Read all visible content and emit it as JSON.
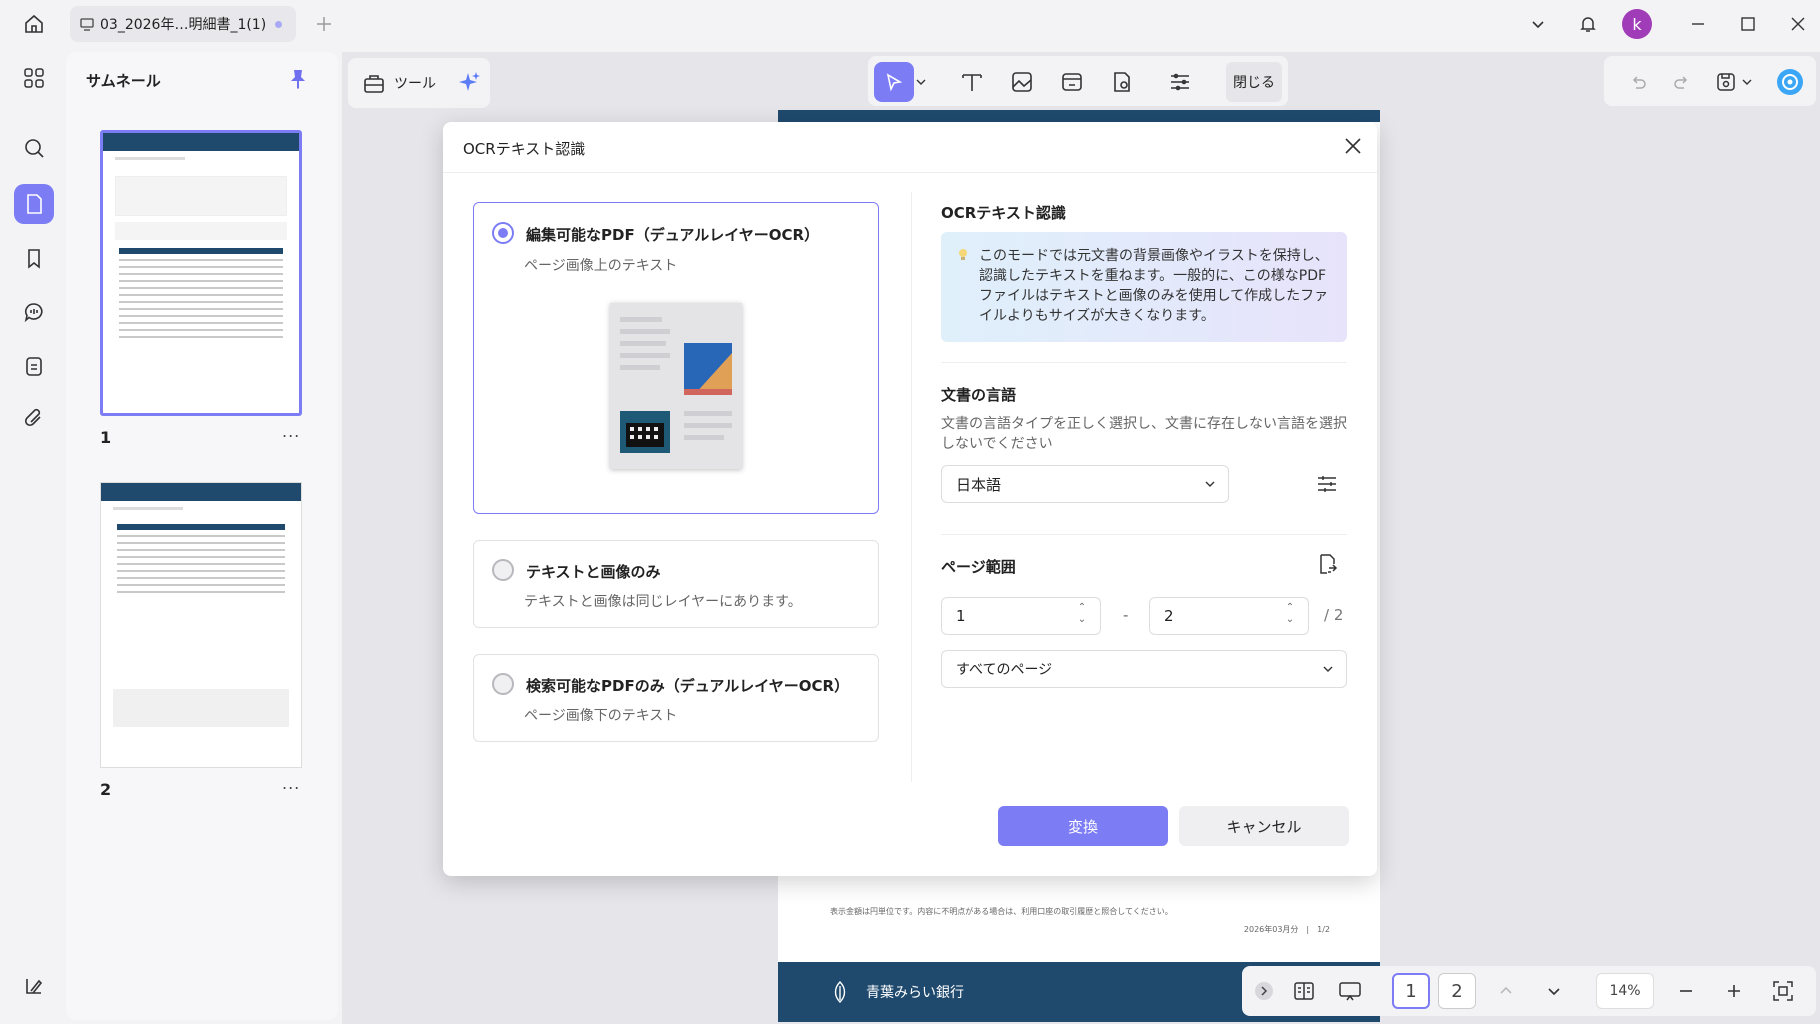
{
  "window": {
    "tab_title": "03_2026年…明細書_1(1)",
    "avatar_letter": "k",
    "accent_color": "#7c7cf5"
  },
  "sidebar": {
    "title": "サムネール",
    "pages": [
      {
        "number": "1",
        "more": "..."
      },
      {
        "number": "2",
        "more": "..."
      }
    ]
  },
  "toolbar": {
    "tools_label": "ツール",
    "close_label": "閉じる"
  },
  "document": {
    "footer_note": "表示金額は円単位です。内容に不明点がある場合は、利用口座の取引履歴と照合してください。",
    "footer_date": "2026年03月分　|　1/2",
    "bank_name": "青葉みらい銀行"
  },
  "bottombar": {
    "page1": "1",
    "page2": "2",
    "zoom": "14%"
  },
  "dialog": {
    "title": "OCRテキスト認識",
    "options": [
      {
        "title": "編集可能なPDF（デュアルレイヤーOCR）",
        "subtitle": "ページ画像上のテキスト"
      },
      {
        "title": "テキストと画像のみ",
        "subtitle": "テキストと画像は同じレイヤーにあります。"
      },
      {
        "title": "検索可能なPDFのみ（デュアルレイヤーOCR）",
        "subtitle": "ページ画像下のテキスト"
      }
    ],
    "right_heading": "OCRテキスト認識",
    "info": "このモードでは元文書の背景画像やイラストを保持し、認識したテキストを重ねます。一般的に、この様なPDFファイルはテキストと画像のみを使用して作成したファイルよりもサイズが大きくなります。",
    "language_heading": "文書の言語",
    "language_desc": "文書の言語タイプを正しく選択し、文書に存在しない言語を選択しないでください",
    "language_value": "日本語",
    "range_heading": "ページ範囲",
    "range_from": "1",
    "range_dash": "-",
    "range_to": "2",
    "range_total": "/ 2",
    "page_select": "すべてのページ",
    "convert_label": "変換",
    "cancel_label": "キャンセル"
  }
}
